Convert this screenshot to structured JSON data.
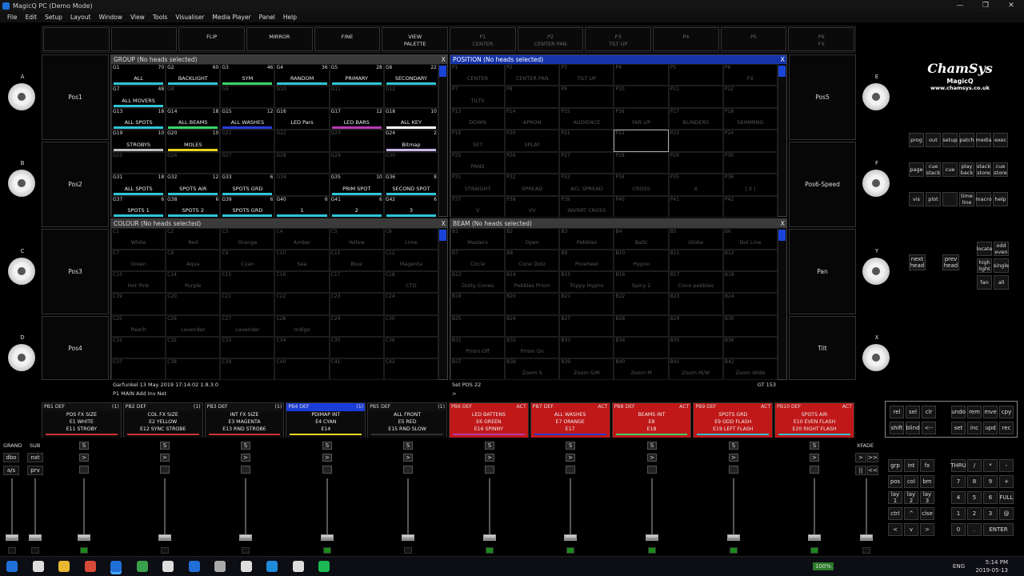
{
  "window": {
    "title": "MagicQ PC (Demo Mode)",
    "controls": [
      "—",
      "❐",
      "✕"
    ]
  },
  "menu": [
    "File",
    "Edit",
    "Setup",
    "Layout",
    "Window",
    "View",
    "Tools",
    "Visualiser",
    "Media Player",
    "Panel",
    "Help"
  ],
  "topbar": [
    {
      "l1": "",
      "l2": "",
      "dim": false
    },
    {
      "l1": "",
      "l2": "",
      "dim": false
    },
    {
      "l1": "FLIP",
      "l2": "",
      "dim": false
    },
    {
      "l1": "MIRROR",
      "l2": "",
      "dim": false
    },
    {
      "l1": "FINE",
      "l2": "",
      "dim": false
    },
    {
      "l1": "VIEW",
      "l2": "PALETTE",
      "dim": false
    },
    {
      "l1": "P1",
      "l2": "CENTER",
      "dim": true
    },
    {
      "l1": "P2",
      "l2": "CENTER PAN",
      "dim": true
    },
    {
      "l1": "P3",
      "l2": "TILT UP",
      "dim": true
    },
    {
      "l1": "P4",
      "l2": "",
      "dim": true
    },
    {
      "l1": "P5",
      "l2": "",
      "dim": true
    },
    {
      "l1": "P6",
      "l2": "FX",
      "dim": true
    }
  ],
  "left_buttons": [
    "Pos1",
    "Pos2",
    "Pos3",
    "Pos4"
  ],
  "right_buttons": [
    "Pos5",
    "Pos6-Speed",
    "Pan",
    "Tilt"
  ],
  "encoders_left": [
    "A",
    "B",
    "C",
    "D"
  ],
  "encoders_right": [
    "E",
    "F",
    "Y",
    "X"
  ],
  "logo": {
    "brand": "ChamSys",
    "product": "MagicQ",
    "url": "www.chamsys.co.uk"
  },
  "group_window": {
    "title": "GROUP (No heads selected)",
    "cells": [
      [
        "G1",
        "70",
        "ALL",
        "#2ec4d6"
      ],
      [
        "G2",
        "60",
        "BACKLIGHT",
        "#2ec4d6"
      ],
      [
        "G3",
        "46",
        "SYM",
        "#39d46a"
      ],
      [
        "G4",
        "36",
        "RANDOM",
        "#2ec4d6"
      ],
      [
        "G5",
        "28",
        "PRIMARY",
        "#2ec4d6"
      ],
      [
        "G6",
        "22",
        "SECONDARY",
        "#2ec4d6"
      ],
      [
        "G7",
        "48",
        "ALL MOVERS",
        "#2ec4d6"
      ],
      [
        "G8",
        "",
        "",
        ""
      ],
      [
        "G9",
        "",
        "",
        ""
      ],
      [
        "G10",
        "",
        "",
        ""
      ],
      [
        "G11",
        "",
        "",
        ""
      ],
      [
        "G12",
        "",
        "",
        ""
      ],
      [
        "G13",
        "18",
        "ALL SPOTS",
        "#2ec4d6"
      ],
      [
        "G14",
        "18",
        "ALL BEAMS",
        "#39d46a"
      ],
      [
        "G15",
        "12",
        "ALL WASHES",
        "#2a3dd8"
      ],
      [
        "G16",
        "",
        "LED Pars",
        ""
      ],
      [
        "G17",
        "12",
        "LED BARS",
        "#b63bb0"
      ],
      [
        "G18",
        "10",
        "ALL KEY",
        "#ffffff"
      ],
      [
        "G19",
        "10",
        "STROBYS",
        "#bdbdbd"
      ],
      [
        "G20",
        "10",
        "MOLES",
        "#e8d51f"
      ],
      [
        "G21",
        "",
        "",
        ""
      ],
      [
        "G22",
        "",
        "",
        ""
      ],
      [
        "G23",
        "",
        "",
        ""
      ],
      [
        "G24",
        "2",
        "Bitmap",
        "#c8b8e8"
      ],
      [
        "G25",
        "",
        "",
        ""
      ],
      [
        "G26",
        "",
        "",
        ""
      ],
      [
        "G27",
        "",
        "",
        ""
      ],
      [
        "G28",
        "",
        "",
        ""
      ],
      [
        "G29",
        "",
        "",
        ""
      ],
      [
        "G30",
        "",
        "",
        ""
      ],
      [
        "G31",
        "18",
        "ALL SPOTS",
        "#2ec4d6"
      ],
      [
        "G32",
        "12",
        "SPOTS AIR",
        "#2ec4d6"
      ],
      [
        "G33",
        "6",
        "SPOTS GRD",
        "#2ec4d6"
      ],
      [
        "G34",
        "",
        "",
        ""
      ],
      [
        "G35",
        "10",
        "PRIM SPOT",
        "#2ec4d6"
      ],
      [
        "G36",
        "8",
        "SECOND SPOT",
        "#2ec4d6"
      ],
      [
        "G37",
        "6",
        "SPOTS 1",
        "#2ec4d6"
      ],
      [
        "G38",
        "6",
        "SPOTS 2",
        "#2ec4d6"
      ],
      [
        "G39",
        "6",
        "SPOTS GRD",
        "#2ec4d6"
      ],
      [
        "G40",
        "6",
        "1",
        "#2ec4d6"
      ],
      [
        "G41",
        "6",
        "2",
        "#2ec4d6"
      ],
      [
        "G42",
        "6",
        "3",
        "#2ec4d6"
      ]
    ]
  },
  "position_window": {
    "title": "POSITION (No heads selected)",
    "cells": [
      [
        "P1",
        "CENTER"
      ],
      [
        "P2",
        "CENTER PAN"
      ],
      [
        "P3",
        "TILT UP"
      ],
      [
        "P4",
        ""
      ],
      [
        "P5",
        ""
      ],
      [
        "P6",
        "FX"
      ],
      [
        "P7",
        "TILTS"
      ],
      [
        "P8",
        ""
      ],
      [
        "P9",
        ""
      ],
      [
        "P10",
        ""
      ],
      [
        "P11",
        ""
      ],
      [
        "P12",
        ""
      ],
      [
        "P13",
        "DOWN"
      ],
      [
        "P14",
        "APRON"
      ],
      [
        "P15",
        "AUDIENCE"
      ],
      [
        "P16",
        "FAR UP"
      ],
      [
        "P17",
        "BLINDERS"
      ],
      [
        "P18",
        "SKIMMING"
      ],
      [
        "P19",
        "SET"
      ],
      [
        "P20",
        "SPLAY"
      ],
      [
        "P21",
        ""
      ],
      [
        "P22",
        ""
      ],
      [
        "P23",
        ""
      ],
      [
        "P24",
        ""
      ],
      [
        "P25",
        "PANS"
      ],
      [
        "P26",
        ""
      ],
      [
        "P27",
        ""
      ],
      [
        "P28",
        ""
      ],
      [
        "P29",
        ""
      ],
      [
        "P30",
        ""
      ],
      [
        "P31",
        "STRAIGHT"
      ],
      [
        "P32",
        "SPREAD"
      ],
      [
        "P33",
        "ACL SPREAD"
      ],
      [
        "P34",
        "CROSS"
      ],
      [
        "P35",
        "X"
      ],
      [
        "P36",
        "| X |"
      ],
      [
        "P37",
        "V"
      ],
      [
        "P38",
        "VV"
      ],
      [
        "P39",
        "INVRRT CROSS"
      ],
      [
        "P40",
        ""
      ],
      [
        "P41",
        ""
      ],
      [
        "P42",
        ""
      ]
    ]
  },
  "colour_window": {
    "title": "COLOUR (No heads selected)",
    "cells": [
      [
        "C1",
        "White"
      ],
      [
        "C2",
        "Red"
      ],
      [
        "C3",
        "Orange"
      ],
      [
        "C4",
        "Amber"
      ],
      [
        "C5",
        "Yellow"
      ],
      [
        "C6",
        "Lime"
      ],
      [
        "C7",
        "Green"
      ],
      [
        "C8",
        "Aqua"
      ],
      [
        "C9",
        "Cyan"
      ],
      [
        "C10",
        "Sea"
      ],
      [
        "C11",
        "Blue"
      ],
      [
        "C12",
        "Magenta"
      ],
      [
        "C13",
        "Hot Pink"
      ],
      [
        "C14",
        "Purple"
      ],
      [
        "C15",
        ""
      ],
      [
        "C16",
        ""
      ],
      [
        "C17",
        ""
      ],
      [
        "C18",
        "CTO"
      ],
      [
        "C19",
        ""
      ],
      [
        "C20",
        ""
      ],
      [
        "C21",
        ""
      ],
      [
        "C22",
        ""
      ],
      [
        "C23",
        ""
      ],
      [
        "C24",
        ""
      ],
      [
        "C25",
        "Peach"
      ],
      [
        "C26",
        "Lavender"
      ],
      [
        "C27",
        "Lavender"
      ],
      [
        "C28",
        "Indigo"
      ],
      [
        "C29",
        ""
      ],
      [
        "C30",
        ""
      ],
      [
        "C31",
        ""
      ],
      [
        "C32",
        ""
      ],
      [
        "C33",
        ""
      ],
      [
        "C34",
        ""
      ],
      [
        "C35",
        ""
      ],
      [
        "C36",
        ""
      ],
      [
        "C37",
        ""
      ],
      [
        "C38",
        ""
      ],
      [
        "C39",
        ""
      ],
      [
        "C40",
        ""
      ],
      [
        "C41",
        ""
      ],
      [
        "C42",
        ""
      ]
    ]
  },
  "beam_window": {
    "title": "BEAM (No heads selected)",
    "cells": [
      [
        "B1",
        "Masters"
      ],
      [
        "B2",
        "Open"
      ],
      [
        "B3",
        "Pebbles"
      ],
      [
        "B4",
        "Ballz"
      ],
      [
        "B5",
        "Globe"
      ],
      [
        "B6",
        "Dot Line"
      ],
      [
        "B7",
        "Circle"
      ],
      [
        "B8",
        "Cone Dotz"
      ],
      [
        "B9",
        "Pinwheel"
      ],
      [
        "B10",
        "Hypno"
      ],
      [
        "B11",
        ""
      ],
      [
        "B12",
        ""
      ],
      [
        "B13",
        "Dotty Cones"
      ],
      [
        "B14",
        "Pebbles Prism"
      ],
      [
        "B15",
        "Trippy Hypno"
      ],
      [
        "B16",
        "Spicy 2"
      ],
      [
        "B17",
        "Cone pebbles"
      ],
      [
        "B18",
        ""
      ],
      [
        "B19",
        ""
      ],
      [
        "B20",
        ""
      ],
      [
        "B21",
        ""
      ],
      [
        "B22",
        ""
      ],
      [
        "B23",
        ""
      ],
      [
        "B24",
        ""
      ],
      [
        "B25",
        ""
      ],
      [
        "B26",
        ""
      ],
      [
        "B27",
        ""
      ],
      [
        "B28",
        ""
      ],
      [
        "B29",
        ""
      ],
      [
        "B30",
        ""
      ],
      [
        "B31",
        "Prism Off"
      ],
      [
        "B32",
        "Prism On"
      ],
      [
        "B33",
        ""
      ],
      [
        "B34",
        ""
      ],
      [
        "B35",
        ""
      ],
      [
        "B36",
        ""
      ],
      [
        "B37",
        ""
      ],
      [
        "B38",
        "Zoom S"
      ],
      [
        "B39",
        "Zoom S/M"
      ],
      [
        "B40",
        "Zoom M"
      ],
      [
        "B41",
        "Zoom M/W"
      ],
      [
        "B42",
        "Zoom Wide"
      ]
    ]
  },
  "status": {
    "left1": "Garfunkel 13 May 2019 17:14:02 1.8.3.0",
    "left2": "P1 MAIN   Add Inv Net",
    "right1": "Set POS 22",
    "right_gt": "GT 153",
    "right2": ">"
  },
  "playbacks": [
    {
      "h": "PB1 DEF",
      "r": "(1)",
      "l1": "POS FX SIZE",
      "l2": "E1 WHITE",
      "l3": "E11 STROBY",
      "bar": "#d03030",
      "bg": "#0b0b0b"
    },
    {
      "h": "PB2 DEF",
      "r": "(1)",
      "l1": "COL FX SIZE",
      "l2": "E2 YELLOW",
      "l3": "E12 SYNC STROBE",
      "bar": "#d03030",
      "bg": "#0b0b0b"
    },
    {
      "h": "PB3 DEF",
      "r": "(1)",
      "l1": "INT FX SIZE",
      "l2": "E3 MAGENTA",
      "l3": "E13 RND STROBE",
      "bar": "#d03030",
      "bg": "#0b0b0b"
    },
    {
      "h": "PB4 DEF",
      "r": "(1)",
      "l1": "PDIMAP INT",
      "l2": "E4 CYAN",
      "l3": "E14",
      "bar": "#e8d51f",
      "bg": "#0b0b0b",
      "hl": "#1c3cd8"
    },
    {
      "h": "PB5 DEF",
      "r": "(1)",
      "l1": "ALL FRONT",
      "l2": "E5 RED",
      "l3": "E15 RND SLOW",
      "bar": "#333",
      "bg": "#0b0b0b"
    },
    {
      "h": "PB6 DEF",
      "r": "ACT",
      "l1": "LED BATTENS",
      "l2": "E6 GREEN",
      "l3": "E16 SPINNY",
      "bar": "#b63bb0",
      "bg": "#c01818"
    },
    {
      "h": "PB7 DEF",
      "r": "ACT",
      "l1": "ALL WASHES",
      "l2": "E7 ORANGE",
      "l3": "E17",
      "bar": "#2a3dd8",
      "bg": "#c01818"
    },
    {
      "h": "PB8 DEF",
      "r": "ACT",
      "l1": "BEAMS INT",
      "l2": "E8",
      "l3": "E18",
      "bar": "#39d46a",
      "bg": "#c01818"
    },
    {
      "h": "PB9 DEF",
      "r": "ACT",
      "l1": "SPOTS GRD",
      "l2": "E9 ODD FLASH",
      "l3": "E19 LEFT FLASH",
      "bar": "#2ec4d6",
      "bg": "#c01818"
    },
    {
      "h": "PB10 DEF",
      "r": "ACT",
      "l1": "SPOTS AIR",
      "l2": "E10 EVEN FLASH",
      "l3": "E20 RIGHT FLASH",
      "bar": "#2ec4d6",
      "bg": "#c01818"
    }
  ],
  "grand_label": "GRAND",
  "sub_label": "SUB",
  "xfade_label": "XFADE",
  "left_small": [
    "dbo",
    "nxt",
    "a/s",
    "prv"
  ],
  "fader_s": "S",
  "fader_go": ">",
  "keypad_top": [
    [
      "prog",
      "out",
      "setup",
      "patch",
      "media",
      "exec"
    ],
    [
      "page",
      "cue stack",
      "cue",
      "play back",
      "stack store",
      "cue store"
    ],
    [
      "vis",
      "plot",
      "",
      "time line",
      "macro",
      "help"
    ]
  ],
  "keypad_mid": [
    [
      "locate",
      "odd even"
    ],
    [
      "high light",
      "single"
    ],
    [
      "fan",
      "all"
    ]
  ],
  "next_head": "next head",
  "prev_head": "prev head",
  "edit_keys": [
    [
      "rel",
      "sel",
      "clr"
    ],
    [
      "shift",
      "blind",
      "<--"
    ]
  ],
  "edit_keys2": [
    [
      "undo",
      "rem",
      "mve",
      "cpy"
    ],
    [
      "set",
      "inc",
      "upd",
      "rec"
    ]
  ],
  "num_left": [
    [
      "grp",
      "int",
      "fx"
    ],
    [
      "pos",
      "col",
      "bm"
    ],
    [
      "lay 1",
      "lay 2",
      "lay 3"
    ],
    [
      "ctrl",
      "^",
      "clse"
    ],
    [
      "<",
      "v",
      ">"
    ]
  ],
  "num_right": [
    [
      "THRU",
      "/",
      "*",
      "-"
    ],
    [
      "7",
      "8",
      "9",
      "+"
    ],
    [
      "4",
      "5",
      "6",
      "FULL"
    ],
    [
      "1",
      "2",
      "3",
      "@"
    ],
    [
      "0",
      ".",
      "ENTER"
    ]
  ],
  "tray": {
    "battery": "100%",
    "lang": "ENG",
    "time": "5:14 PM",
    "date": "2019-05-13"
  }
}
